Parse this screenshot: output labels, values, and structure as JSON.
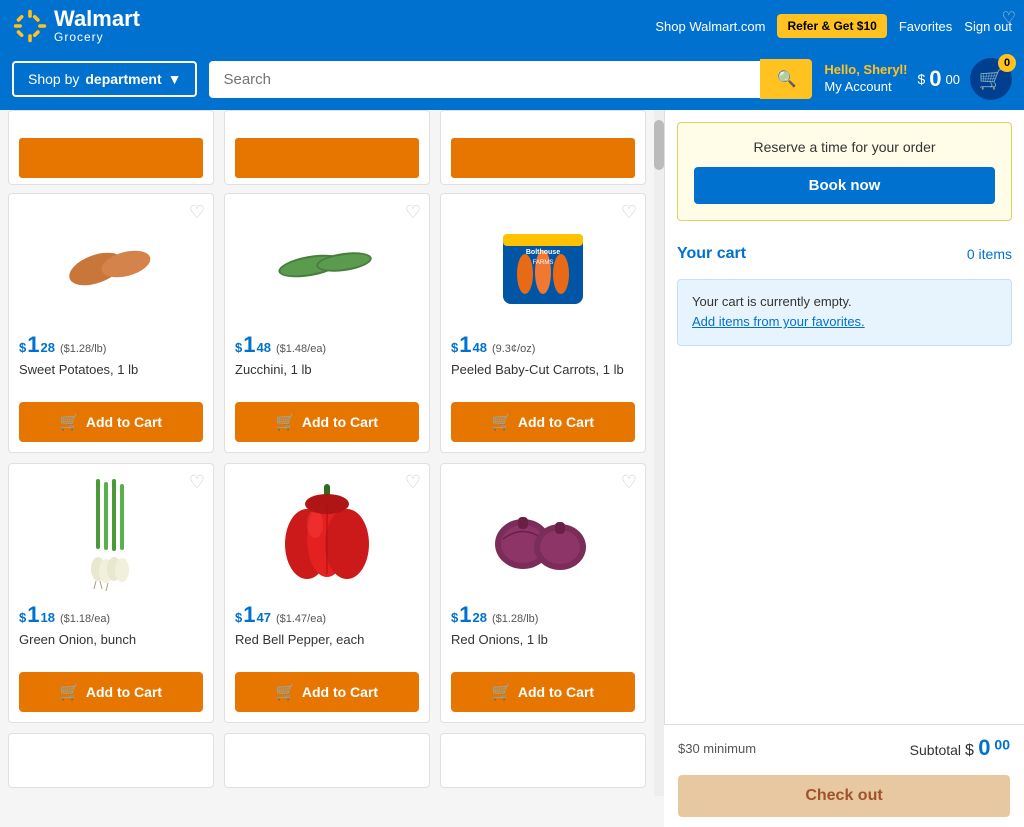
{
  "header": {
    "logo_walmart": "Walmart",
    "logo_grocery": "Grocery",
    "shop_walmart_label": "Shop Walmart.com",
    "refer_label": "Refer & Get $10",
    "favorites_label": "Favorites",
    "signout_label": "Sign out"
  },
  "navbar": {
    "dept_label_prefix": "Shop by ",
    "dept_label_bold": "department",
    "search_placeholder": "Search",
    "search_btn_label": "🔍",
    "hello_line1": "Hello, Sheryl!",
    "hello_line2": "My Account",
    "cart_amount": "$",
    "cart_dollars": "0",
    "cart_superscript": "00",
    "cart_badge": "0"
  },
  "sidebar": {
    "reserve_title": "Reserve a time for your order",
    "book_now_label": "Book now",
    "your_cart_label": "Your cart",
    "items_count": "0 items",
    "cart_empty_text": "Your cart is currently empty.",
    "cart_favorites_link": "Add items from your favorites.",
    "minimum_text": "$30 minimum",
    "subtotal_label": "Subtotal",
    "subtotal_dollars": "0",
    "subtotal_cents": "00",
    "checkout_label": "Check out"
  },
  "stubs": [
    {
      "has_bar": true
    },
    {
      "has_bar": true
    },
    {
      "has_bar": true
    }
  ],
  "products": [
    {
      "name": "Sweet Potatoes, 1 lb",
      "price_whole": "1",
      "price_cents": "28",
      "price_unit": "($1.28/lb)",
      "color": "sweet_potato",
      "add_label": "Add to Cart"
    },
    {
      "name": "Zucchini, 1 lb",
      "price_whole": "1",
      "price_cents": "48",
      "price_unit": "($1.48/ea)",
      "color": "zucchini",
      "add_label": "Add to Cart"
    },
    {
      "name": "Peeled Baby-Cut Carrots, 1 lb",
      "price_whole": "1",
      "price_cents": "48",
      "price_unit": "(9.3¢/oz)",
      "color": "carrots",
      "add_label": "Add to Cart"
    },
    {
      "name": "Green Onion, bunch",
      "price_whole": "1",
      "price_cents": "18",
      "price_unit": "($1.18/ea)",
      "color": "green_onion",
      "add_label": "Add to Cart"
    },
    {
      "name": "Red Bell Pepper, each",
      "price_whole": "1",
      "price_cents": "47",
      "price_unit": "($1.47/ea)",
      "color": "red_pepper",
      "add_label": "Add to Cart"
    },
    {
      "name": "Red Onions, 1 lb",
      "price_whole": "1",
      "price_cents": "28",
      "price_unit": "($1.28/lb)",
      "color": "red_onion",
      "add_label": "Add to Cart"
    }
  ],
  "bottom_stubs": [
    {
      "has_bar": false
    },
    {
      "has_bar": false
    },
    {
      "has_bar": false
    }
  ]
}
